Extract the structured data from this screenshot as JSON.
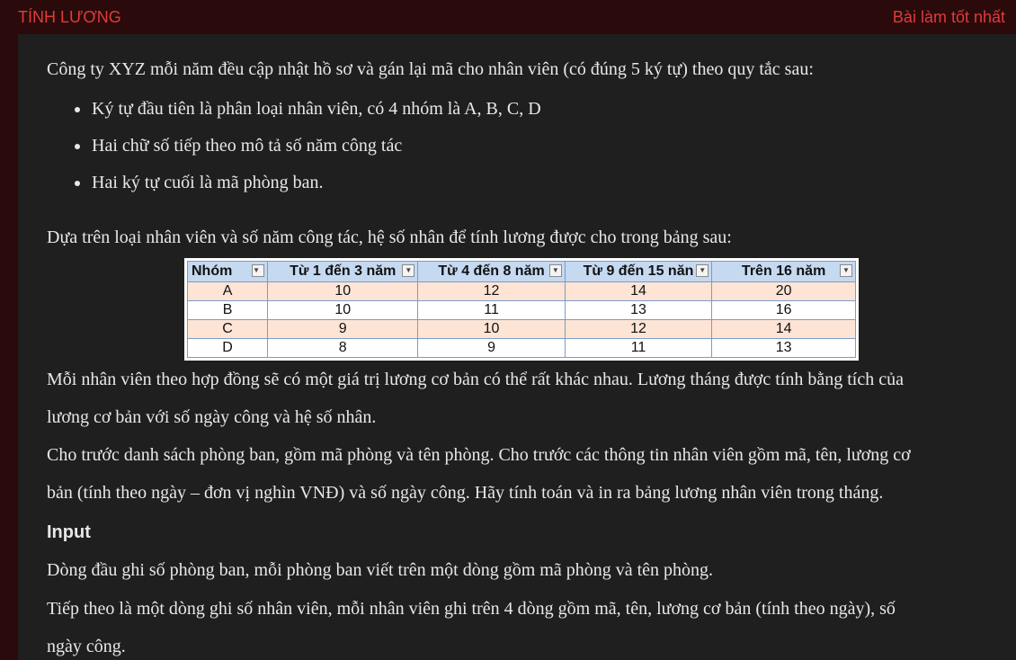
{
  "header": {
    "title": "TÍNH LƯƠNG",
    "best_link": "Bài làm tốt nhất"
  },
  "content": {
    "intro": "Công ty XYZ mỗi năm đều cập nhật hồ sơ và gán lại mã cho nhân viên (có đúng 5 ký tự) theo quy tắc sau:",
    "bullets": [
      "Ký tự đầu tiên là phân loại nhân viên, có 4 nhóm là A, B, C, D",
      "Hai chữ số tiếp theo mô tả số năm công tác",
      "Hai ký tự cuối là mã phòng ban."
    ],
    "table_intro": "Dựa trên loại nhân viên và số năm công tác, hệ số nhân để tính lương được cho trong bảng sau:",
    "table": {
      "headers": [
        "Nhóm",
        "Từ 1 đến 3 năm",
        "Từ 4 đến 8 năm",
        "Từ 9 đến 15 năn",
        "Trên 16 năm"
      ],
      "rows": [
        [
          "A",
          "10",
          "12",
          "14",
          "20"
        ],
        [
          "B",
          "10",
          "11",
          "13",
          "16"
        ],
        [
          "C",
          "9",
          "10",
          "12",
          "14"
        ],
        [
          "D",
          "8",
          "9",
          "11",
          "13"
        ]
      ]
    },
    "para1_line1": "Mỗi nhân viên theo hợp đồng sẽ có một giá trị lương cơ bản có thể rất khác nhau. Lương tháng được tính bằng tích của",
    "para1_line2": "lương cơ bản với số ngày công và hệ số nhân.",
    "para2_line1": "Cho trước danh sách phòng ban, gồm mã phòng và tên phòng. Cho trước các thông tin nhân viên gồm mã, tên, lương cơ",
    "para2_line2": "bản (tính theo ngày – đơn vị nghìn VNĐ) và số ngày công. Hãy tính toán và in ra bảng lương nhân viên trong tháng.",
    "input_heading": "Input",
    "input_line1": "Dòng đầu ghi số phòng ban, mỗi phòng ban viết trên một dòng gồm mã phòng và tên phòng.",
    "input_line2": "Tiếp theo là một dòng ghi số nhân viên, mỗi nhân viên ghi trên 4 dòng gồm mã, tên, lương cơ bản (tính theo ngày), số",
    "input_line3": "ngày công."
  }
}
